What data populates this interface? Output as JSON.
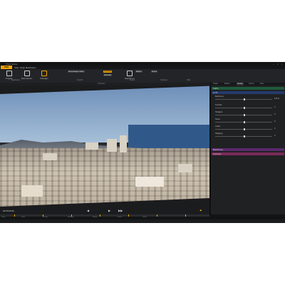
{
  "app": {
    "title": "Photo Editor",
    "menu": [
      "Start",
      "Datei",
      "Bearbeiten"
    ],
    "logo": "PRO"
  },
  "ribbon": {
    "buttons": [
      {
        "label": "Projekt",
        "icon": "file-icon"
      },
      {
        "label": "Exportieren",
        "icon": "export-icon"
      },
      {
        "label": "Vorlagen",
        "icon": "templates-icon"
      },
      {
        "label": "Speichern",
        "icon": "save-icon"
      }
    ],
    "chips": [
      {
        "label": "Stereoskopie Video"
      },
      {
        "label": "Vorschau",
        "orange": true
      },
      {
        "label": "Standard"
      },
      {
        "label": "Effekte"
      },
      {
        "label": "Export"
      }
    ],
    "groups": [
      "Bearbeiten",
      "Ansicht",
      "Export",
      "Optionen",
      "Hilfe"
    ]
  },
  "preview": {
    "caption": "Vorschau"
  },
  "transport": {
    "timecode": "00:00:00:00",
    "controls": [
      "prev-icon",
      "play-icon",
      "next-icon"
    ],
    "controls_glyphs": [
      "◀",
      "▶",
      "▶▶"
    ]
  },
  "timeline": {
    "labels": [
      "Status",
      "Dauer",
      "Position",
      "Auflösung",
      "Bildrate",
      "Format",
      "Größe"
    ]
  },
  "panel": {
    "tabs": [
      "Stapel",
      "Effekte",
      "Details",
      "Ordner",
      "Filter"
    ],
    "active_tab": 3,
    "sections": [
      {
        "title": "Farbe",
        "color": "green"
      },
      {
        "title": "Licht",
        "color": "blue"
      },
      {
        "title": "Belichtung",
        "color": "purple"
      },
      {
        "title": "Kontrast",
        "color": "magenta"
      }
    ],
    "sliders": [
      {
        "label": "Belichtung",
        "value": "100 %",
        "level": 0.5
      },
      {
        "label": "Kontrast",
        "value": "0",
        "level": 0.5
      },
      {
        "label": "Helligkeit",
        "value": "0",
        "level": 0.5
      },
      {
        "label": "Tiefen",
        "value": "0",
        "level": 0.5
      },
      {
        "label": "Lichter",
        "value": "0",
        "level": 0.5
      },
      {
        "label": "Sättigung",
        "value": "0",
        "level": 0.5
      }
    ]
  }
}
